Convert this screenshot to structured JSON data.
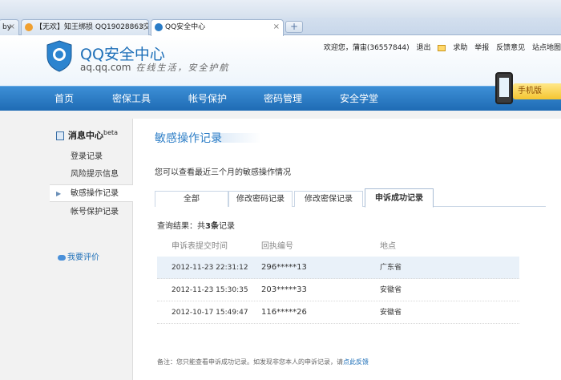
{
  "browser": {
    "tabs": [
      {
        "label": "by"
      },
      {
        "label": "【无欢】知王绑损  QQ19028863交"
      },
      {
        "label": "QQ安全中心",
        "active": true
      }
    ],
    "newtab_label": "+",
    "close_glyph": "×"
  },
  "header": {
    "title": "QQ安全中心",
    "domain": "aq.qq.com",
    "slogan": "在线生活，安全护航",
    "user_greeting": "欢迎您，蒲宙(36557844)",
    "links": [
      "退出",
      "求助",
      "举报",
      "反馈意见",
      "站点地图"
    ]
  },
  "nav": {
    "items": [
      "首页",
      "密保工具",
      "帐号保护",
      "密码管理",
      "安全学堂"
    ],
    "promo_label": "手机版"
  },
  "sidebar": {
    "heading": "消息中心",
    "heading_badge": "beta",
    "items": [
      "登录记录",
      "风险提示信息",
      "敏感操作记录",
      "帐号保护记录"
    ],
    "active_index": 2,
    "feedback": "我要评价"
  },
  "main": {
    "title": "敏感操作记录",
    "intro": "您可以查看最近三个月的敏感操作情况",
    "tabs": [
      "全部",
      "修改密码记录",
      "修改密保记录",
      "申诉成功记录"
    ],
    "active_tab": 3,
    "result_prefix": "查询结果：共",
    "result_count": "3条",
    "result_suffix": "记录",
    "columns": [
      "申诉表提交时间",
      "回执编号",
      "地点"
    ],
    "rows": [
      [
        "2012-11-23 22:31:12",
        "296*****13",
        "广东省"
      ],
      [
        "2012-11-23 15:30:35",
        "203*****33",
        "安徽省"
      ],
      [
        "2012-10-17 15:49:47",
        "116*****26",
        "安徽省"
      ]
    ],
    "note_text": "备注：您只能查看申诉成功记录。如发现非您本人的申诉记录，请",
    "note_link": "点此反馈"
  },
  "colors": {
    "accent": "#1d6fb8",
    "nav_bg": "#2a7cc7",
    "highlight_row": "#e9f1f9"
  }
}
